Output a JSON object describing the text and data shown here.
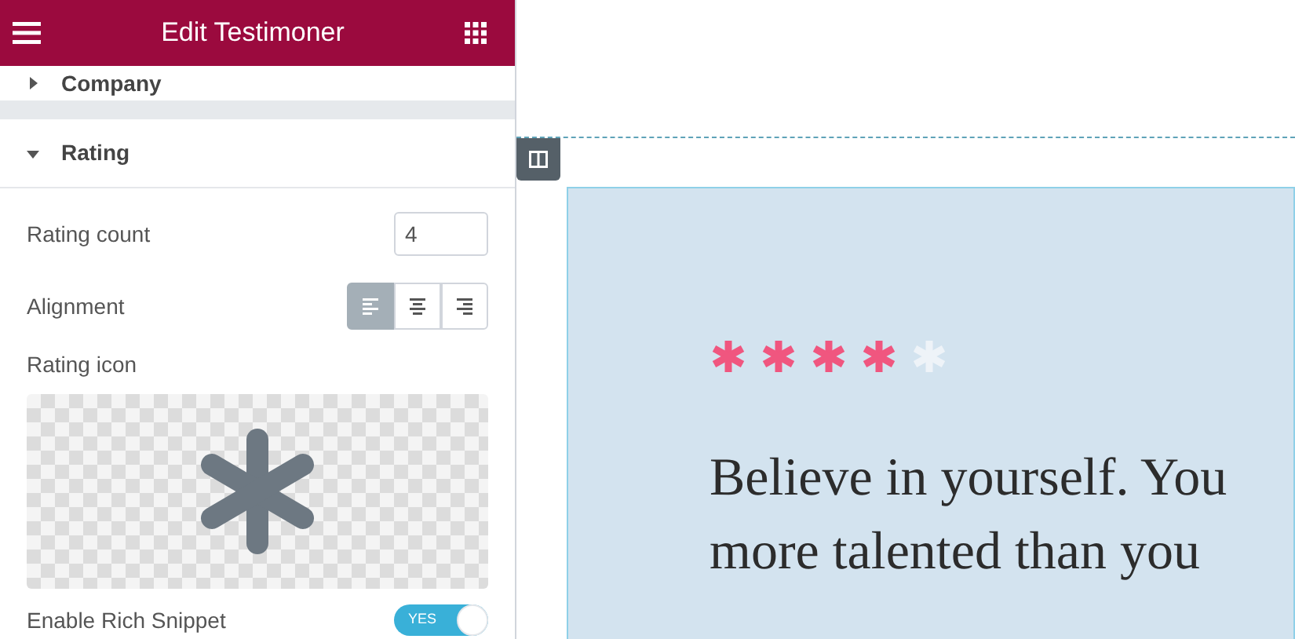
{
  "panel": {
    "title": "Edit Testimoner",
    "sections": [
      {
        "label": "Company",
        "expanded": false
      },
      {
        "label": "Rating",
        "expanded": true
      }
    ]
  },
  "rating": {
    "count_label": "Rating count",
    "count_value": "4",
    "alignment_label": "Alignment",
    "alignment_options": [
      {
        "kind": "left",
        "selected": true
      },
      {
        "kind": "center",
        "selected": false
      },
      {
        "kind": "right",
        "selected": false
      }
    ],
    "icon_label": "Rating icon",
    "rich_snippet_label": "Enable Rich Snippet",
    "rich_snippet": {
      "on": true,
      "text": "YES"
    }
  },
  "preview": {
    "stars": 4,
    "quote_lines": [
      "Believe in yourself. You",
      "more talented than you"
    ]
  }
}
